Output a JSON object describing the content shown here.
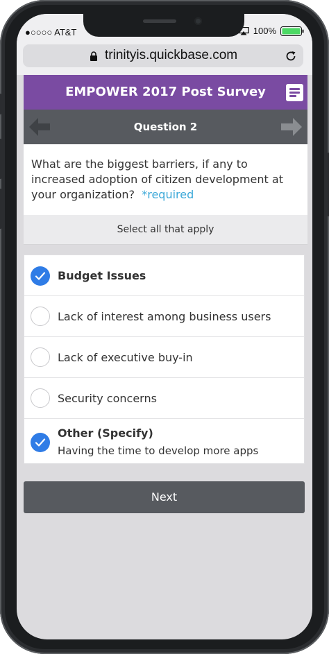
{
  "status_bar": {
    "carrier": "●○○○○ AT&T",
    "battery": "100%"
  },
  "browser": {
    "url": "trinityis.quickbase.com"
  },
  "header": {
    "title": "EMPOWER 2017 Post Survey"
  },
  "question_nav": {
    "title": "Question 2"
  },
  "question": {
    "text": "What are the biggest barriers, if any to increased adoption of citizen development at your organization?",
    "required_label": "*required"
  },
  "instruction": "Select all that apply",
  "options": [
    {
      "label": "Budget Issues",
      "checked": true
    },
    {
      "label": "Lack of interest among business users",
      "checked": false
    },
    {
      "label": "Lack of executive buy-in",
      "checked": false
    },
    {
      "label": "Security concerns",
      "checked": false
    },
    {
      "label": "Other (Specify)",
      "checked": true,
      "detail": "Having the time to develop more apps"
    }
  ],
  "next_label": "Next",
  "colors": {
    "header_purple": "#7a4ba2",
    "nav_gray": "#575a5f",
    "check_blue": "#2f7ce6",
    "required_blue": "#3ba8d8",
    "battery_green": "#4cd964"
  }
}
